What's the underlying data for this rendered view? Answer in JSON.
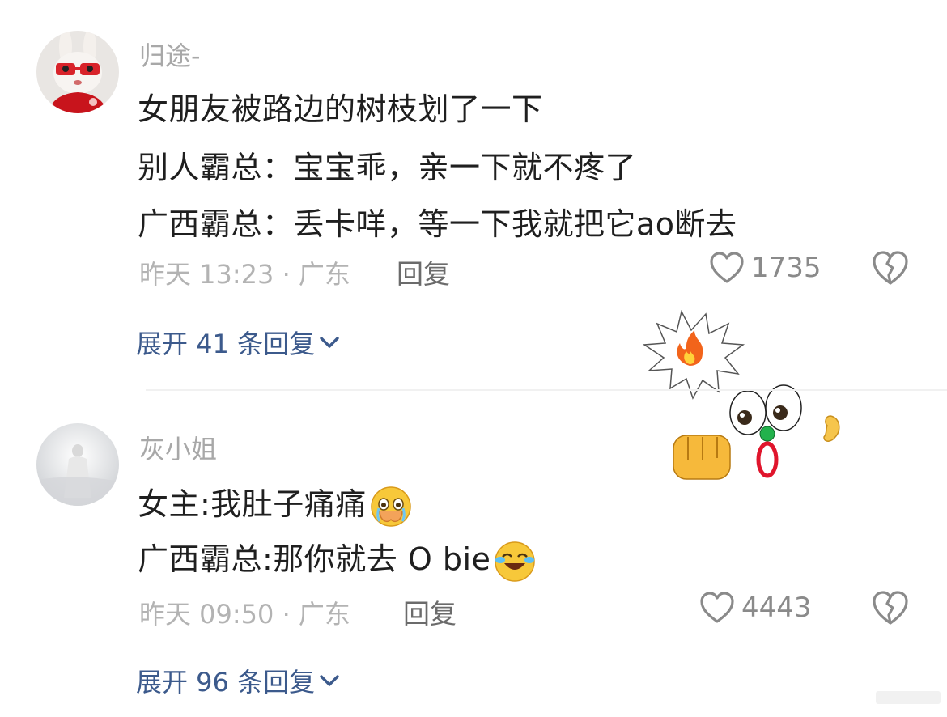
{
  "comments": [
    {
      "username": "归途-",
      "lines": [
        "女朋友被路边的树枝划了一下",
        "别人霸总：宝宝乖，亲一下就不疼了",
        "广西霸总：丢卡咩，等一下我就把它ao断去"
      ],
      "meta": "昨天 13:23 · 广东",
      "reply_label": "回复",
      "likes": "1735",
      "expand_label": "展开 41 条回复"
    },
    {
      "username": "灰小姐",
      "lines": [
        "女主:我肚子痛痛",
        "广西霸总:那你就去 O bie"
      ],
      "meta": "昨天 09:50 · 广东",
      "reply_label": "回复",
      "likes": "4443",
      "expand_label": "展开 96 条回复"
    }
  ],
  "icons": {
    "like": "heart-outline-icon",
    "dislike": "broken-heart-icon",
    "expand": "chevron-down-icon"
  },
  "colors": {
    "link_blue": "#3c5a8c",
    "meta_gray": "#b3b3b3",
    "username_gray": "#a8a8a8"
  }
}
